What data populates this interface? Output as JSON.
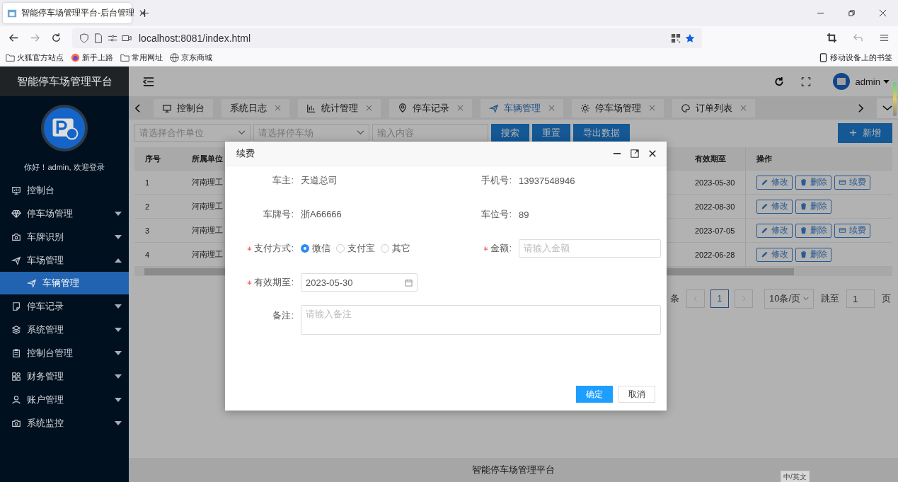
{
  "browser": {
    "tab_title": "智能停车场管理平台-后台管理",
    "url": "localhost:8081/index.html",
    "bookmarks": [
      {
        "label": "火狐官方站点",
        "kind": "folder"
      },
      {
        "label": "新手上路",
        "kind": "firefox"
      },
      {
        "label": "常用网址",
        "kind": "folder"
      },
      {
        "label": "京东商城",
        "kind": "globe"
      }
    ],
    "mobile_bookmarks": "移动设备上的书签"
  },
  "sidebar": {
    "title": "智能停车场管理平台",
    "greeting": "你好！admin, 欢迎登录",
    "menu": [
      {
        "label": "控制台",
        "kind": "link"
      },
      {
        "label": "停车场管理",
        "kind": "group",
        "expanded": false
      },
      {
        "label": "车牌识别",
        "kind": "group",
        "expanded": false
      },
      {
        "label": "车场管理",
        "kind": "group",
        "expanded": true,
        "children": [
          {
            "label": "车辆管理",
            "selected": true
          }
        ]
      },
      {
        "label": "停车记录",
        "kind": "group",
        "expanded": false
      },
      {
        "label": "系统管理",
        "kind": "group",
        "expanded": false
      },
      {
        "label": "控制台管理",
        "kind": "group",
        "expanded": false
      },
      {
        "label": "财务管理",
        "kind": "group",
        "expanded": false
      },
      {
        "label": "账户管理",
        "kind": "group",
        "expanded": false
      },
      {
        "label": "系统监控",
        "kind": "group",
        "expanded": false
      }
    ]
  },
  "header": {
    "user": "admin"
  },
  "tabs": [
    {
      "label": "控制台",
      "selected": false,
      "closable": false
    },
    {
      "label": "系统日志",
      "selected": false,
      "closable": true
    },
    {
      "label": "统计管理",
      "selected": false,
      "closable": true
    },
    {
      "label": "停车记录",
      "selected": false,
      "closable": true
    },
    {
      "label": "车辆管理",
      "selected": true,
      "closable": true
    },
    {
      "label": "停车场管理",
      "selected": false,
      "closable": true
    },
    {
      "label": "订单列表",
      "selected": false,
      "closable": true
    }
  ],
  "toolbar": {
    "filters": [
      {
        "kind": "select",
        "placeholder": "请选择合作单位"
      },
      {
        "kind": "select",
        "placeholder": "请选择停车场"
      },
      {
        "kind": "input",
        "placeholder": "输入内容"
      }
    ],
    "buttons": [
      "搜索",
      "重置",
      "导出数据"
    ],
    "add_button": "新增"
  },
  "table": {
    "columns": [
      "序号",
      "所属单位",
      "有效期至",
      "操作"
    ],
    "rows": [
      {
        "index": "1",
        "unit": "河南理工",
        "expires": "2023-05-30",
        "actions": [
          {
            "label": "修改",
            "kind": "edit"
          },
          {
            "label": "删除",
            "kind": "delete"
          },
          {
            "label": "续费",
            "kind": "renew"
          }
        ]
      },
      {
        "index": "2",
        "unit": "河南理工",
        "expires": "2022-08-30",
        "actions": [
          {
            "label": "修改",
            "kind": "edit"
          },
          {
            "label": "删除",
            "kind": "delete"
          }
        ]
      },
      {
        "index": "3",
        "unit": "河南理工",
        "expires": "2023-07-05",
        "actions": [
          {
            "label": "修改",
            "kind": "edit"
          },
          {
            "label": "删除",
            "kind": "delete"
          },
          {
            "label": "续费",
            "kind": "renew"
          }
        ]
      },
      {
        "index": "4",
        "unit": "河南理工",
        "expires": "2022-06-28",
        "actions": [
          {
            "label": "修改",
            "kind": "edit"
          },
          {
            "label": "删除",
            "kind": "delete"
          }
        ]
      }
    ]
  },
  "pagination": {
    "total_suffix": "条",
    "current": "1",
    "page_size": "10条/页",
    "jump_label": "跳至",
    "jump_value": "1",
    "page_suffix": "页"
  },
  "dialog": {
    "title": "续费",
    "fields": [
      {
        "label": "车主:",
        "kind": "text",
        "required": false,
        "value": "天道总司"
      },
      {
        "label": "手机号:",
        "kind": "text",
        "required": false,
        "value": "13937548946"
      },
      {
        "label": "车牌号:",
        "kind": "text",
        "required": false,
        "value": "浙A66666"
      },
      {
        "label": "车位号:",
        "kind": "text",
        "required": false,
        "value": "89"
      },
      {
        "label": "支付方式:",
        "kind": "radio",
        "required": true,
        "options": [
          {
            "label": "微信",
            "selected": true
          },
          {
            "label": "支付宝",
            "selected": false
          },
          {
            "label": "其它",
            "selected": false
          }
        ]
      },
      {
        "label": "金额:",
        "kind": "input",
        "required": true,
        "placeholder": "请输入金额"
      },
      {
        "label": "有效期至:",
        "kind": "date",
        "required": true,
        "value": "2023-05-30"
      },
      {
        "label": "备注:",
        "kind": "textarea",
        "required": false,
        "placeholder": "请输入备注"
      }
    ],
    "buttons": [
      {
        "label": "确定",
        "kind": "primary"
      },
      {
        "label": "取消",
        "kind": "default"
      }
    ]
  },
  "footer": {
    "text": "智能停车场管理平台"
  },
  "ime_indicator": "中/英文"
}
